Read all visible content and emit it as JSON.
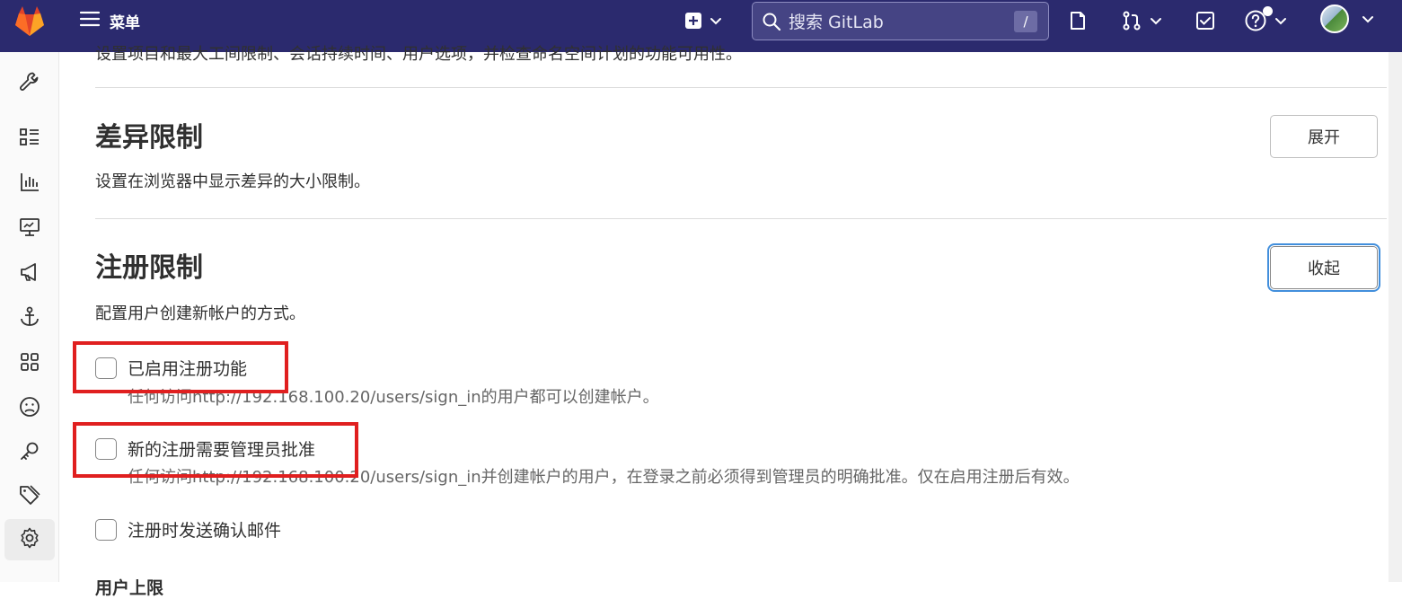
{
  "colors": {
    "topbar": "#2b2a6e",
    "search_bg": "#454484",
    "highlight": "#e01f1f",
    "focus_ring": "#428fdc",
    "logo_orange": "#e24329",
    "logo_light": "#fca326"
  },
  "header": {
    "logo_icon": "gitlab-logo",
    "menu_icon": "hamburger-icon",
    "menu_label": "菜单",
    "create_icon": "plus-square-icon",
    "search_icon": "search-icon",
    "search_placeholder": "搜索 GitLab",
    "search_shortcut": "/",
    "issues_icon": "issues-icon",
    "merge_requests_icon": "merge-request-icon",
    "todos_icon": "todo-check-icon",
    "help_icon": "help-icon",
    "avatar_icon": "user-avatar"
  },
  "sidebar": {
    "items": [
      {
        "name": "admin-overview",
        "icon": "wrench-icon"
      },
      {
        "name": "overview",
        "icon": "list-icon"
      },
      {
        "name": "analytics",
        "icon": "chart-icon"
      },
      {
        "name": "monitoring",
        "icon": "monitor-icon"
      },
      {
        "name": "messages",
        "icon": "megaphone-icon"
      },
      {
        "name": "system-hooks",
        "icon": "anchor-icon"
      },
      {
        "name": "applications",
        "icon": "apps-icon"
      },
      {
        "name": "abuse-reports",
        "icon": "sad-face-icon"
      },
      {
        "name": "deploy-keys",
        "icon": "key-icon"
      },
      {
        "name": "labels",
        "icon": "labels-icon"
      },
      {
        "name": "settings",
        "icon": "gear-icon",
        "active": true
      }
    ]
  },
  "main": {
    "cut_off_text": "设置项目和最大工间限制、会话持续时间、用户选项，并检查命名空间计划的功能可用性。",
    "diff_section": {
      "title": "差异限制",
      "description": "设置在浏览器中显示差异的大小限制。",
      "button_label": "展开"
    },
    "signup_section": {
      "title": "注册限制",
      "description": "配置用户创建新帐户的方式。",
      "button_label": "收起",
      "options": [
        {
          "label": "已启用注册功能",
          "checked": false,
          "help": "任何访问http://192.168.100.20/users/sign_in的用户都可以创建帐户。"
        },
        {
          "label": "新的注册需要管理员批准",
          "checked": false,
          "help": "任何访问http://192.168.100.20/users/sign_in并创建帐户的用户，在登录之前必须得到管理员的明确批准。仅在启用注册后有效。"
        },
        {
          "label": "注册时发送确认邮件",
          "checked": false
        }
      ],
      "next_heading": "用户上限"
    }
  }
}
